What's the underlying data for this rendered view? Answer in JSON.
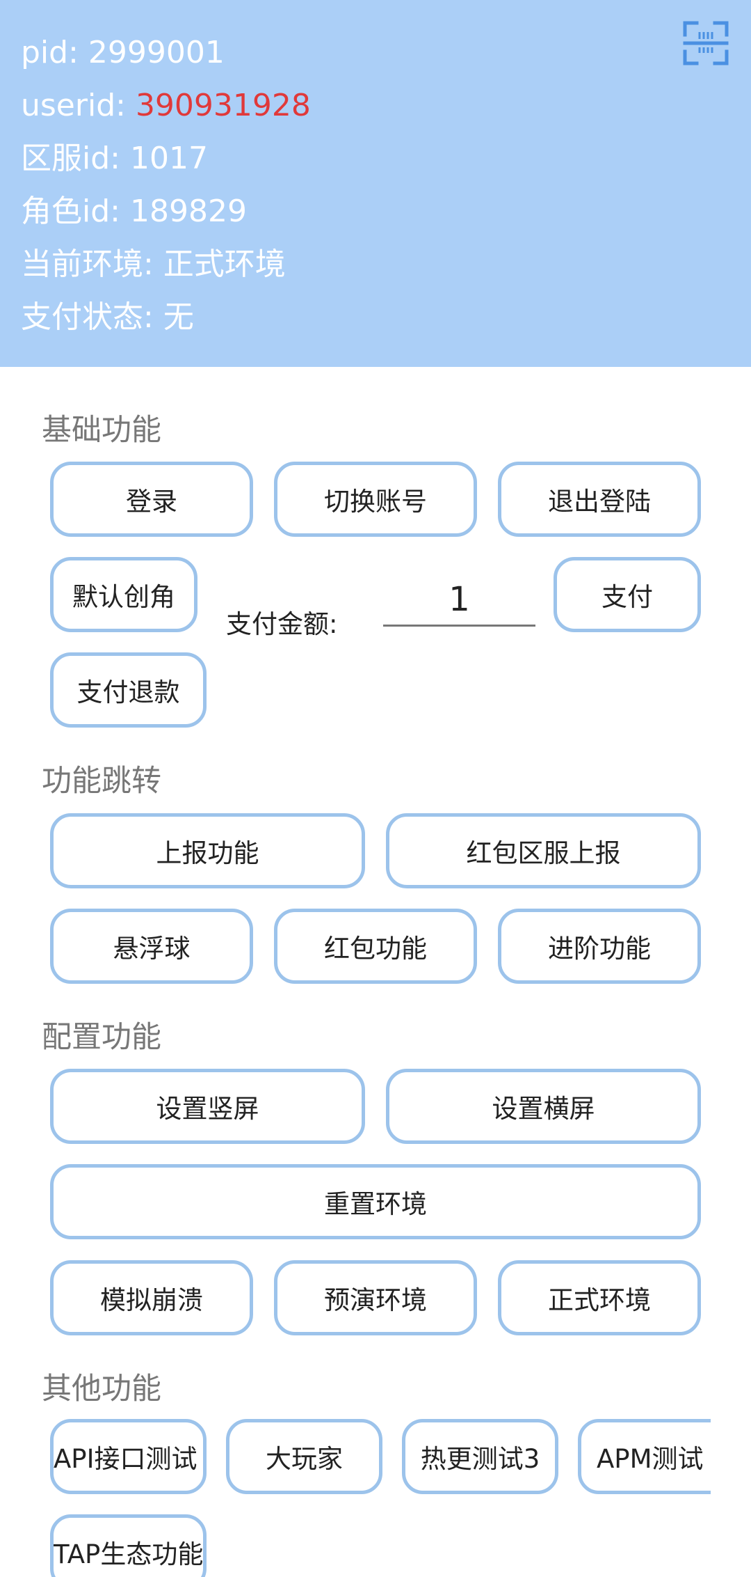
{
  "info": {
    "pid_label": "pid: ",
    "pid_value": "2999001",
    "userid_label": "userid: ",
    "userid_value": "390931928",
    "server_label": "区服id: ",
    "server_value": "1017",
    "role_label": "角色id: ",
    "role_value": "189829",
    "env_label": "当前环境: ",
    "env_value": "正式环境",
    "pay_label": "支付状态: ",
    "pay_value": "无",
    "scan_icon": "scan-icon",
    "userid_color": "#e0393a",
    "header_bg": "#abcff7"
  },
  "basic": {
    "title": "基础功能",
    "login": "登录",
    "switch_account": "切换账号",
    "logout": "退出登陆",
    "default_create_role": "默认创角",
    "pay_amount_label": "支付金额:",
    "pay_amount_value": "1",
    "pay": "支付",
    "refund": "支付退款"
  },
  "jump": {
    "title": "功能跳转",
    "report": "上报功能",
    "redpacket_server_report": "红包区服上报",
    "float_ball": "悬浮球",
    "redpacket": "红包功能",
    "advanced": "进阶功能"
  },
  "config": {
    "title": "配置功能",
    "portrait": "设置竖屏",
    "landscape": "设置横屏",
    "reset_env": "重置环境",
    "crash": "模拟崩溃",
    "preview_env": "预演环境",
    "prod_env": "正式环境"
  },
  "other": {
    "title": "其他功能",
    "api_test": "API接口测试",
    "big_player": "大玩家",
    "hotfix_test": "热更测试3",
    "apm_test": "APM测试",
    "tap_eco": "TAP生态功能"
  },
  "colors": {
    "button_border": "#9cc3eb",
    "section_title": "#777777"
  }
}
